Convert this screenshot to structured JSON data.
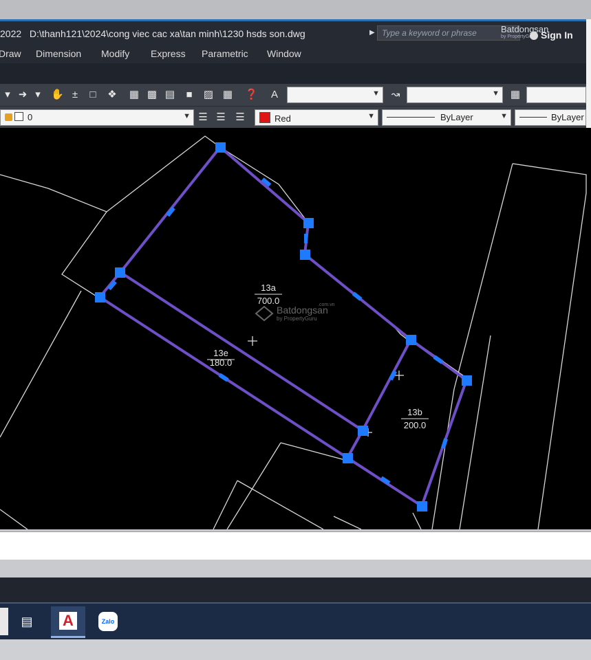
{
  "window": {
    "title_prefix": "2022",
    "file_path": "D:\\thanh121\\2024\\cong viec cac xa\\tan minh\\1230 hsds son.dwg",
    "search_placeholder": "Type a keyword or phrase",
    "sign_in": "Sign In",
    "watermark_brand": "Batdongsan",
    "watermark_sub": "by PropertyGuru"
  },
  "menu": [
    "Draw",
    "Dimension",
    "Modify",
    "Express",
    "Parametric",
    "Window"
  ],
  "layer_toolbar": {
    "layer_name": "0",
    "color": "Red",
    "linetype": "ByLayer",
    "lineweight": "ByLayer"
  },
  "drawing": {
    "parcels": [
      {
        "id": "13a",
        "area": "700.0"
      },
      {
        "id": "13e",
        "area": "180.0"
      },
      {
        "id": "13b",
        "area": "200.0"
      }
    ],
    "watermark": "Batdongsan",
    "watermark_domain": ".com.vn",
    "watermark_sub": "by PropertyGuru",
    "colors": {
      "background": "#000000",
      "lines": "#d8d8d8",
      "selected_boundary": "#6f4fc7",
      "grips": "#1e7bff"
    }
  },
  "taskbar": {
    "apps": [
      "task-view",
      "AutoCAD",
      "Zalo"
    ],
    "autocad_label": "A",
    "zalo_label": "Zalo"
  }
}
